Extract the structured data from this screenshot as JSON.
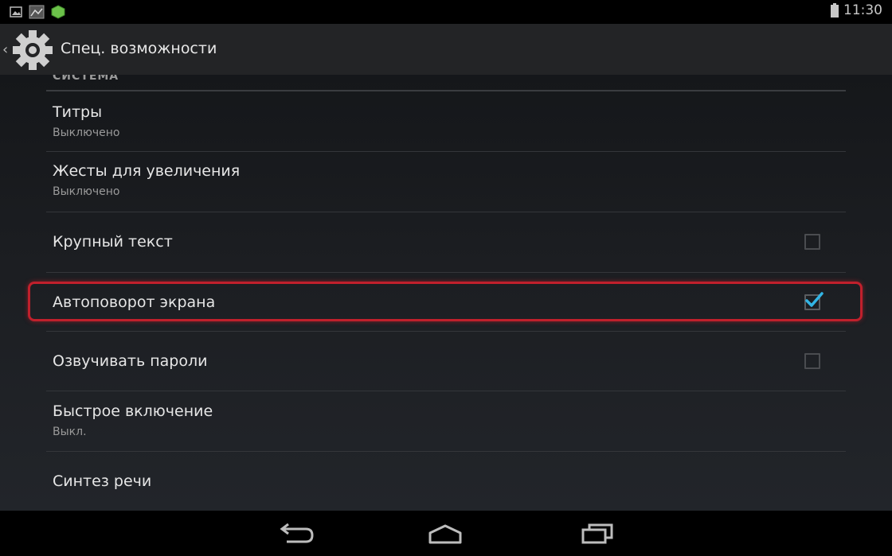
{
  "status_bar": {
    "time": "11:30",
    "icons": [
      "picture-icon",
      "image-notification-icon",
      "app-notification-icon",
      "battery-icon"
    ]
  },
  "action_bar": {
    "title": "Спец. возможности",
    "icon": "settings-gear-icon"
  },
  "section": {
    "header": "СИСТЕМА"
  },
  "settings": [
    {
      "title": "Титры",
      "summary": "Выключено"
    },
    {
      "title": "Жесты для увеличения",
      "summary": "Выключено"
    },
    {
      "title": "Крупный текст",
      "checked": false
    },
    {
      "title": "Автоповорот экрана",
      "checked": true
    },
    {
      "title": "Озвучивать пароли",
      "checked": false
    },
    {
      "title": "Быстрое включение",
      "summary": "Выкл."
    },
    {
      "title": "Синтез речи"
    }
  ],
  "colors": {
    "accent": "#33b5e5",
    "highlight": "#c0202c"
  },
  "nav_bar": {
    "icons": [
      "back-icon",
      "home-icon",
      "recents-icon"
    ]
  }
}
